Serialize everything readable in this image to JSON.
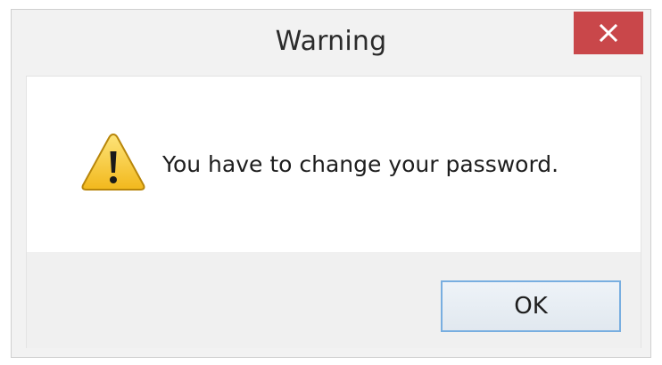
{
  "window": {
    "title": "Warning"
  },
  "dialog": {
    "message": "You have to change your password.",
    "icon": "warning-icon"
  },
  "buttons": {
    "ok_label": "OK"
  },
  "colors": {
    "close_button_bg": "#c9474a",
    "ok_border": "#78aee0",
    "warning_yellow": "#f6c62d"
  }
}
